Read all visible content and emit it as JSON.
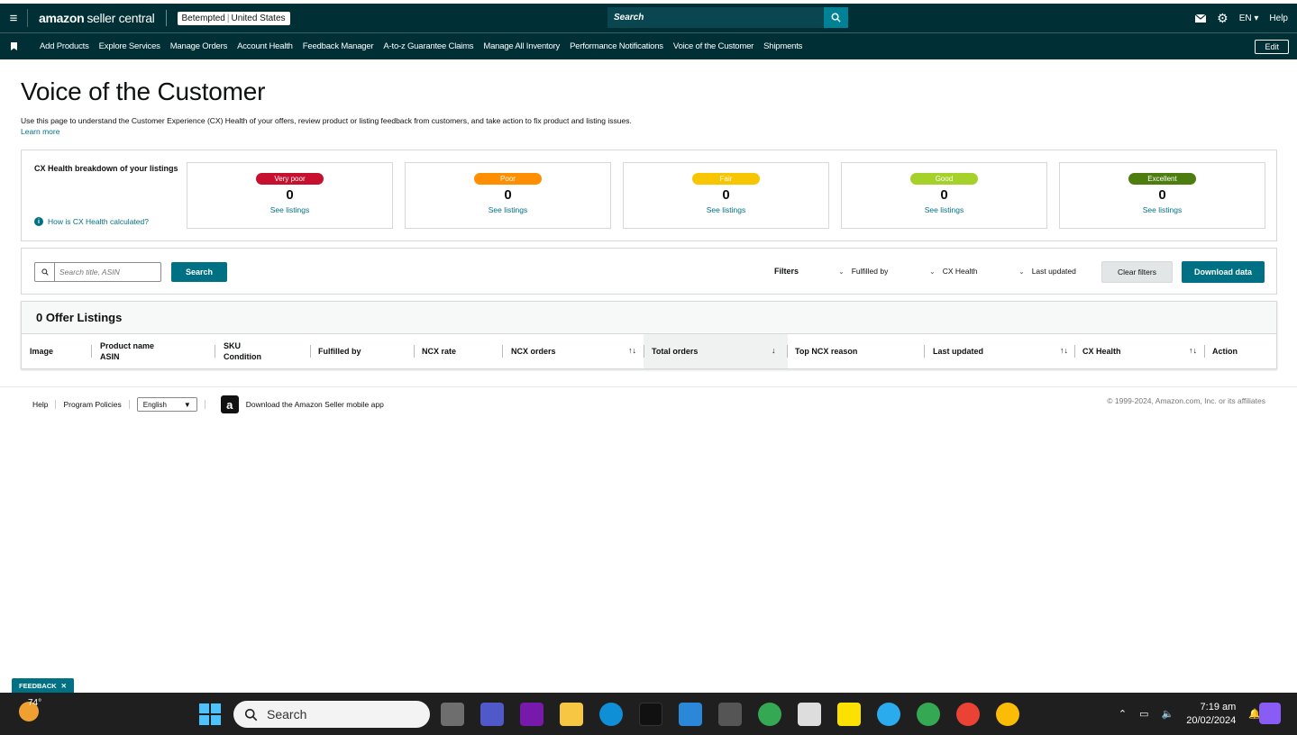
{
  "topbar": {
    "brand_amazon": "amazon",
    "brand_rest": "seller central",
    "store": "Betempted",
    "marketplace": "United States",
    "search_placeholder": "Search",
    "lang": "EN ▾",
    "help": "Help"
  },
  "nav": {
    "items": [
      "Add Products",
      "Explore Services",
      "Manage Orders",
      "Account Health",
      "Feedback Manager",
      "A-to-z Guarantee Claims",
      "Manage All Inventory",
      "Performance Notifications",
      "Voice of the Customer",
      "Shipments"
    ],
    "edit": "Edit"
  },
  "page": {
    "title": "Voice of the Customer",
    "description": "Use this page to understand the Customer Experience (CX) Health of your offers, review product or listing feedback from customers, and take action to fix product and listing issues.",
    "learn_more": "Learn more"
  },
  "cx": {
    "title": "CX Health breakdown of your listings",
    "how": "How is CX Health calculated?",
    "cards": [
      {
        "label": "Very poor",
        "count": "0",
        "link": "See listings",
        "color": "#c7102f"
      },
      {
        "label": "Poor",
        "count": "0",
        "link": "See listings",
        "color": "#ff8f00"
      },
      {
        "label": "Fair",
        "count": "0",
        "link": "See listings",
        "color": "#f8c600"
      },
      {
        "label": "Good",
        "count": "0",
        "link": "See listings",
        "color": "#a5d12a"
      },
      {
        "label": "Excellent",
        "count": "0",
        "link": "See listings",
        "color": "#4d7c0f"
      }
    ]
  },
  "filters": {
    "search_placeholder": "Search title, ASIN",
    "search_button": "Search",
    "label": "Filters",
    "fulfilled_by": "Fulfilled by",
    "cx_health": "CX Health",
    "last_updated": "Last updated",
    "clear": "Clear filters",
    "download": "Download data"
  },
  "table": {
    "heading": "0 Offer Listings",
    "columns": {
      "image": "Image",
      "product_name": "Product name",
      "asin": "ASIN",
      "sku": "SKU",
      "condition": "Condition",
      "fulfilled_by": "Fulfilled by",
      "ncx_rate": "NCX rate",
      "ncx_orders": "NCX orders",
      "total_orders": "Total orders",
      "top_ncx_reason": "Top NCX reason",
      "last_updated": "Last updated",
      "cx_health": "CX Health",
      "action": "Action"
    }
  },
  "footer": {
    "help": "Help",
    "policies": "Program Policies",
    "language": "English",
    "app": "Download the Amazon Seller mobile app",
    "copyright": "© 1999-2024, Amazon.com, Inc. or its affiliates"
  },
  "feedback": "FEEDBACK",
  "taskbar": {
    "temp": "74°",
    "search": "Search",
    "time": "7:19 am",
    "date": "20/02/2024"
  }
}
